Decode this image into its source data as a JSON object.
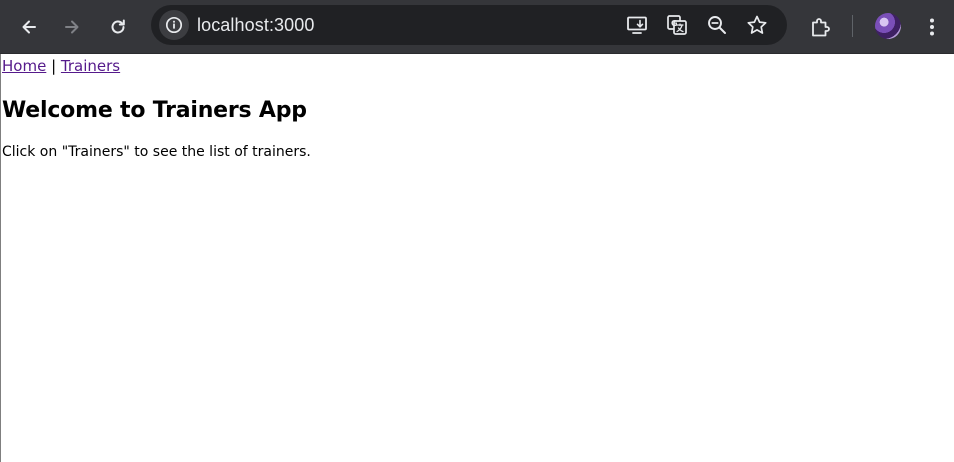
{
  "browser": {
    "url": "localhost:3000",
    "icons": {
      "back": "back-arrow-icon",
      "forward": "forward-arrow-icon",
      "reload": "reload-icon",
      "site_info": "info-icon",
      "install": "install-app-icon",
      "translate": "translate-icon",
      "zoom": "zoom-out-icon",
      "bookmark": "star-icon",
      "extensions": "puzzle-icon",
      "menu": "kebab-menu-icon"
    },
    "colors": {
      "toolbar": "#35363a",
      "omnibox": "#202124",
      "icon": "#e8eaed",
      "icon_disabled": "#7f8186"
    }
  },
  "page": {
    "nav": {
      "home": "Home",
      "separator": "|",
      "trainers": "Trainers"
    },
    "heading": "Welcome to Trainers App",
    "description": "Click on \"Trainers\" to see the list of trainers.",
    "colors": {
      "link": "#551a8b",
      "text": "#000000"
    }
  }
}
